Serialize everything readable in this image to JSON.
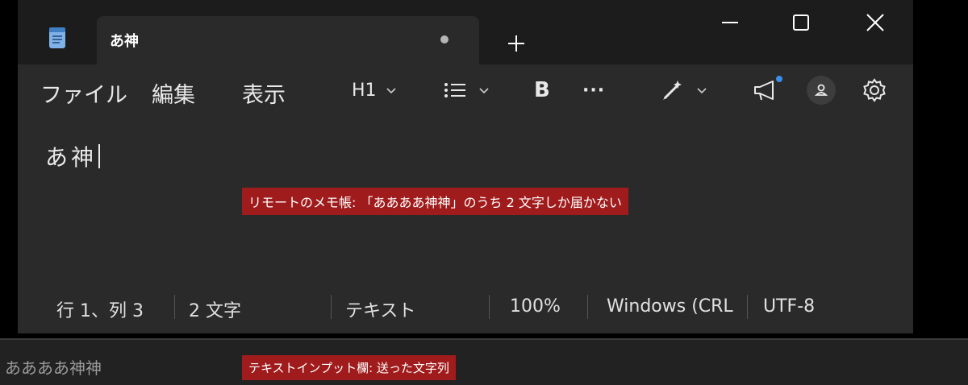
{
  "tab": {
    "title": "あ神"
  },
  "menu": {
    "file": "ファイル",
    "edit": "編集",
    "view": "表示"
  },
  "toolbar": {
    "heading": "H1",
    "bold": "B",
    "more": "···"
  },
  "editor": {
    "content": "あ神"
  },
  "status": {
    "position": "行 1、列 3",
    "chars": "2 文字",
    "mode": "テキスト",
    "zoom": "100%",
    "line_ending": "Windows (CRL",
    "encoding": "UTF-8"
  },
  "annotations": {
    "remote": "リモートのメモ帳: 「ああああ神神」のうち 2 文字しか届かない",
    "input": "テキストインプット欄: 送った文字列"
  },
  "input": {
    "value": "ああああ神神"
  },
  "colors": {
    "window_bg": "#1c1c1c",
    "pane_bg": "#2a2a2a",
    "annotation_bg": "#a01c1c",
    "notification_dot": "#3b8eea"
  },
  "icons": [
    "notepad-icon",
    "tab-modified-dot-icon",
    "plus-icon",
    "minimize-icon",
    "maximize-icon",
    "close-icon",
    "list-icon",
    "copilot-pen-icon",
    "megaphone-icon",
    "account-icon",
    "gear-icon",
    "chevron-down-icon"
  ]
}
